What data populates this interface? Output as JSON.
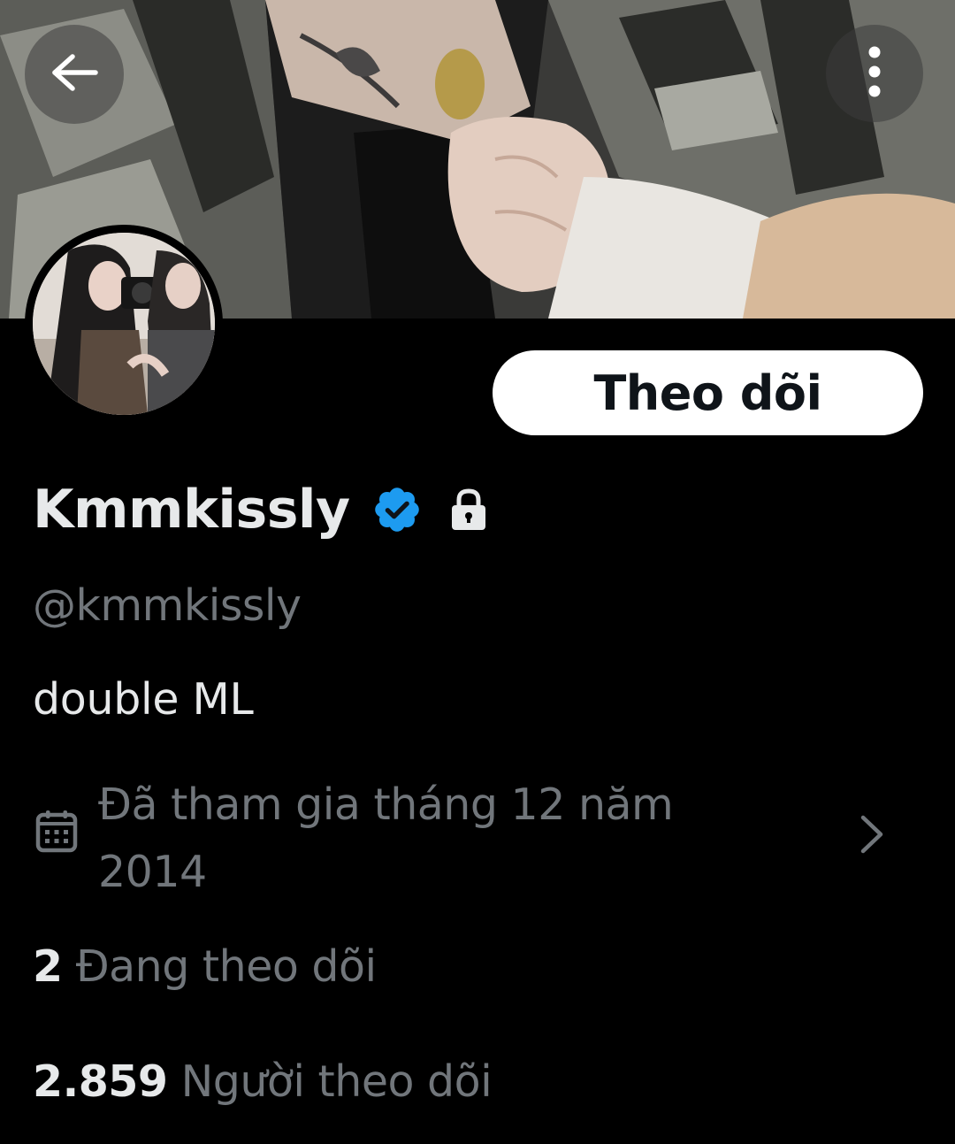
{
  "profile": {
    "display_name": "Kmmkissly",
    "handle": "@kmmkissly",
    "bio": "double ML",
    "joined": "Đã tham gia tháng 12 năm 2014",
    "verified": true,
    "protected": true
  },
  "actions": {
    "follow_label": "Theo dõi"
  },
  "stats": {
    "following_count": "2",
    "following_label": "Đang theo dõi",
    "followers_count": "2.859",
    "followers_label": "Người theo dõi"
  },
  "colors": {
    "background": "#000000",
    "verified_badge": "#1d9bf0",
    "muted_text": "#71767b",
    "primary_text": "#e7e9ea"
  },
  "icons": {
    "back": "arrow-left-icon",
    "more": "more-vertical-icon",
    "verified": "verified-badge-icon",
    "lock": "lock-icon",
    "calendar": "calendar-icon",
    "chevron": "chevron-right-icon"
  }
}
